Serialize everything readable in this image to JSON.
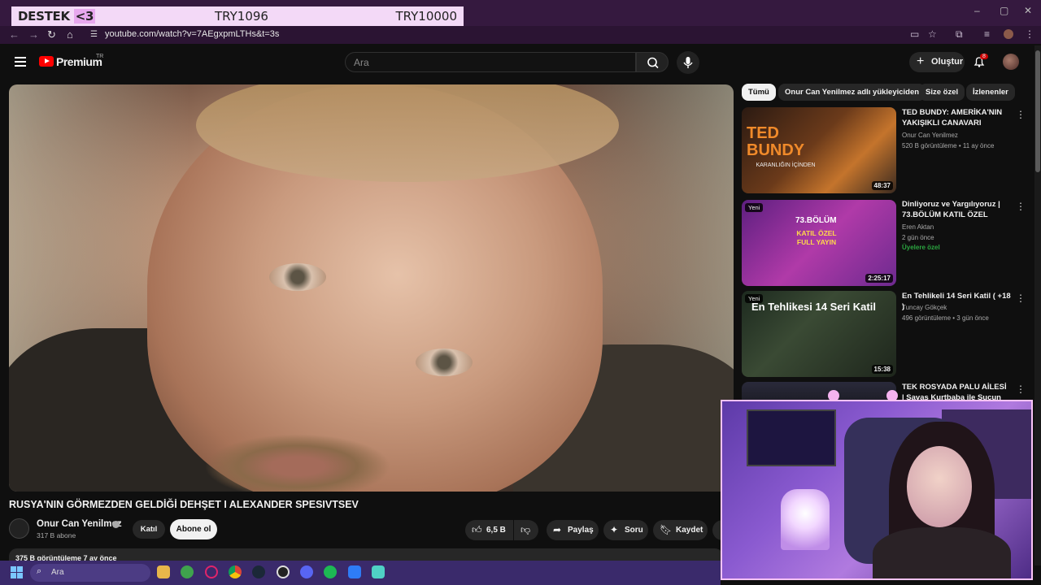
{
  "browser": {
    "url": "youtube.com/watch?v=7AEgxpmLTHs&t=3s",
    "window_controls": [
      "–",
      "▢",
      "✕"
    ]
  },
  "donation": {
    "label_prefix": "DESTEK",
    "label_suffix": "<3",
    "current": "TRY1096",
    "goal": "TRY10000"
  },
  "header": {
    "brand": "Premium",
    "region": "TR",
    "search_placeholder": "Ara",
    "create_label": "Oluştur",
    "notifications_count": "8"
  },
  "video": {
    "title": "RUSYA'NIN GÖRMEZDEN GELDİĞİ DEHŞET I ALEXANDER SPESIVTSEV",
    "channel": "Onur Can Yenilmez",
    "subscribers": "317 B abone",
    "join_label": "Katıl",
    "subscribe_label": "Abone ol",
    "likes": "6,5 B",
    "share_label": "Paylaş",
    "ask_label": "Soru",
    "save_label": "Kaydet",
    "description_preview": "375 B görüntüleme  7 ay önce"
  },
  "chips": [
    "Tümü",
    "Onur Can Yenilmez adlı yükleyiciden",
    "Size özel",
    "İzlenenler"
  ],
  "related": [
    {
      "title": "TED BUNDY: AMERİKA'NIN YAKIŞIKLI CANAVARI",
      "channel": "Onur Can Yenilmez",
      "meta": "520 B görüntüleme • 11 ay önce",
      "duration": "48:37",
      "thumb_text": "TED BUNDY",
      "thumb_sub": "KARANLIĞIN İÇİNDEN"
    },
    {
      "title": "Dinliyoruz ve Yargılıyoruz | 73.BÖLÜM KATIL ÖZEL",
      "channel": "Eren Aktan",
      "meta": "2 gün önce",
      "badge": "Yeni",
      "members": "Üyelere özel",
      "duration": "2:25:17",
      "thumb_text": "73.BÖLÜM",
      "thumb_sub": "KATIL ÖZEL FULL YAYIN"
    },
    {
      "title": "En Tehlikeli 14 Seri Katil ( +18 )",
      "channel": "Tuncay Gökçek",
      "meta": "496 görüntüleme • 3 gün önce",
      "badge": "Yeni",
      "duration": "15:38",
      "thumb_text": "En Tehlikesi 14 Seri Katil"
    },
    {
      "title": "TEK ROSYADA PALU AİLESİ | Savaş Kurtbaba ile Suçun ...",
      "channel": "",
      "meta": ""
    }
  ],
  "taskbar": {
    "search_placeholder": "Ara"
  }
}
